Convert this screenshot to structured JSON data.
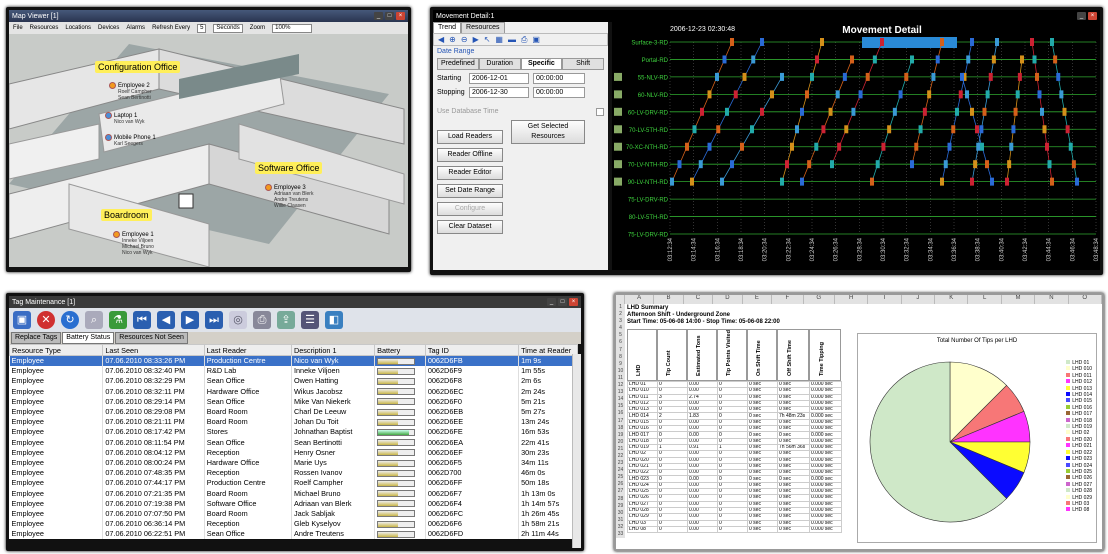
{
  "map_viewer": {
    "title": "Map Viewer [1]",
    "menu": [
      "File",
      "Resources",
      "Locations",
      "Devices",
      "Alarms"
    ],
    "refresh_label": "Refresh Every",
    "refresh_value": "5",
    "refresh_unit": "Seconds",
    "zoom_label": "Zoom",
    "zoom_value": "100%",
    "rooms": {
      "config": "Configuration Office",
      "software": "Software Office",
      "boardroom": "Boardroom"
    },
    "employees": [
      {
        "name": "Employee 2",
        "sub": [
          "Roelf Campher",
          "Sean Bertinotti"
        ]
      },
      {
        "name": "Laptop 1",
        "sub": [
          "Nico van Wyk"
        ]
      },
      {
        "name": "Mobile Phone 1",
        "sub": [
          "Karl Seegers"
        ]
      },
      {
        "name": "Employee 3",
        "sub": [
          "Adriaan van Blerk",
          "Andre Treutens",
          "Willie Claasen"
        ]
      },
      {
        "name": "Employee 1",
        "sub": [
          "Inneke Viljoen",
          "Michael Bruno",
          "Nico van Wyk"
        ]
      }
    ]
  },
  "movement": {
    "title": "Movement Detail:1",
    "tabs": [
      "Trend",
      "Resources"
    ],
    "date_range_label": "Date Range",
    "range_tabs": [
      "Predefined",
      "Duration",
      "Specific",
      "Shift"
    ],
    "starting_label": "Starting",
    "starting_date": "2006-12-01",
    "starting_time": "00:00:00",
    "stopping_label": "Stopping",
    "stopping_date": "2006-12-30",
    "stopping_time": "00:00:00",
    "use_db_time": "Use Database Time",
    "buttons": {
      "load": "Load Readers",
      "get": "Get Selected Resources",
      "offline": "Reader Offline",
      "editor": "Reader Editor",
      "set": "Set Date Range",
      "configure": "Configure",
      "clear": "Clear Dataset"
    },
    "chart_title": "Movement Detail",
    "timestamp": "2006-12-23 02:30:48",
    "lanes": [
      "Surface-3-RD",
      "Portal-RD",
      "55-NLV-RD",
      "60-NLV-RD",
      "60-LV-DRV-RD",
      "70-LV-5TH-RD",
      "70-XC-NTH-RD",
      "70-LV-NTH-RD",
      "90-LV-NTH-RD",
      "75-LV-DRV-RD",
      "80-LV-5TH-RD",
      "75-LV-DRV-RD"
    ],
    "times": [
      "03:12:34",
      "03:14:34",
      "03:16:34",
      "03:18:34",
      "03:20:34",
      "03:22:34",
      "03:24:34",
      "03:26:34",
      "03:28:34",
      "03:30:34",
      "03:32:34",
      "03:34:34",
      "03:36:34",
      "03:38:34",
      "03:40:34",
      "03:42:34",
      "03:44:34",
      "03:46:34",
      "03:48:34"
    ]
  },
  "tag_maint": {
    "title": "Tag Maintenance [1]",
    "tabs": [
      "Replace Tags",
      "Battery Status",
      "Resources Not Seen"
    ],
    "columns": [
      "Resource Type",
      "Last Seen",
      "Last Reader",
      "Description 1",
      "Battery",
      "Tag ID",
      "Time at Reader"
    ],
    "rows": [
      [
        "Employee",
        "07.06.2010 08:33:26 PM",
        "Production Centre",
        "Nico van Wyk",
        "0.55",
        "0062D6FB",
        "1m 9s"
      ],
      [
        "Employee",
        "07.06.2010 08:32:40 PM",
        "R&D Lab",
        "Inneke Viljoen",
        "0.55",
        "0062D6F9",
        "1m 55s"
      ],
      [
        "Employee",
        "07.06.2010 08:32:29 PM",
        "Sean Office",
        "Owen Hatting",
        "0.55",
        "0062D6F8",
        "2m 6s"
      ],
      [
        "Employee",
        "07.06.2010 08:32:11 PM",
        "Hardware Office",
        "Wikus Jacobsz",
        "0.55",
        "0062D6EC",
        "2m 24s"
      ],
      [
        "Employee",
        "07.06.2010 08:29:14 PM",
        "Sean Office",
        "Mike Van Niekerk",
        "0.55",
        "0062D6F0",
        "5m 21s"
      ],
      [
        "Employee",
        "07.06.2010 08:29:08 PM",
        "Board Room",
        "Charl De Leeuw",
        "0.55",
        "0062D6EB",
        "5m 27s"
      ],
      [
        "Employee",
        "07.06.2010 08:21:11 PM",
        "Board Room",
        "Johan Du Toit",
        "0.55",
        "0062D6EE",
        "13m 24s"
      ],
      [
        "Employee",
        "07.06.2010 08:17:42 PM",
        "Stores",
        "Johnathan Baptist",
        "0.85",
        "0062D6FE",
        "16m 53s"
      ],
      [
        "Employee",
        "07.06.2010 08:11:54 PM",
        "Sean Office",
        "Sean Bertinotti",
        "0.55",
        "0062D6EA",
        "22m 41s"
      ],
      [
        "Employee",
        "07.06.2010 08:04:12 PM",
        "Reception",
        "Henry Osner",
        "0.55",
        "0062D6EF",
        "30m 23s"
      ],
      [
        "Employee",
        "07.06.2010 08:00:24 PM",
        "Hardware Office",
        "Marie Uys",
        "0.55",
        "0062D6F5",
        "34m 11s"
      ],
      [
        "Employee",
        "07.06.2010 07:48:35 PM",
        "Reception",
        "Rossen Ivanov",
        "0.55",
        "0062D700",
        "46m 0s"
      ],
      [
        "Employee",
        "07.06.2010 07:44:17 PM",
        "Production Centre",
        "Roelf Campher",
        "0.55",
        "0062D6FF",
        "50m 18s"
      ],
      [
        "Employee",
        "07.06.2010 07:21:35 PM",
        "Board Room",
        "Michael Bruno",
        "0.55",
        "0062D6F7",
        "1h 13m 0s"
      ],
      [
        "Employee",
        "07.06.2010 07:19:38 PM",
        "Software Office",
        "Adriaan van Blerk",
        "0.55",
        "0062D6F4",
        "1h 14m 57s"
      ],
      [
        "Employee",
        "07.06.2010 07:07:50 PM",
        "Board Room",
        "Jack Sabljak",
        "0.55",
        "0062D6FC",
        "1h 26m 45s"
      ],
      [
        "Employee",
        "07.06.2010 06:36:14 PM",
        "Reception",
        "Gleb Kyselyov",
        "0.55",
        "0062D6F6",
        "1h 58m 21s"
      ],
      [
        "Employee",
        "07.06.2010 06:22:51 PM",
        "Sean Office",
        "Andre Treutens",
        "0.55",
        "0062D6FD",
        "2h 11m 44s"
      ]
    ]
  },
  "excel": {
    "columns": [
      "A",
      "B",
      "C",
      "D",
      "E",
      "F",
      "G",
      "H",
      "I",
      "J",
      "K",
      "L",
      "M",
      "N",
      "O"
    ],
    "title1": "LHD Summary",
    "title2": "Afternoon Shift - Underground Zone",
    "title3": "Start Time: 05-06-08 14:00 - Stop Time: 05-06-08 22:00",
    "headers": [
      "LHD",
      "Tip Count",
      "Estimated Tons",
      "Tip Points Visited",
      "On Shift Time",
      "Off Shift Time",
      "Time Tipping"
    ],
    "rows": [
      [
        "LHD 01",
        "0",
        "0.00",
        "0",
        "0 sec",
        "0 sec",
        "0.000 sec"
      ],
      [
        "LHD 010",
        "0",
        "0.00",
        "0",
        "0 sec",
        "0 sec",
        "0.000 sec"
      ],
      [
        "LHD 011",
        "3",
        "2.74",
        "0",
        "0 sec",
        "0 sec",
        "0.000 sec"
      ],
      [
        "LHD 012",
        "0",
        "0.00",
        "0",
        "0 sec",
        "0 sec",
        "0.000 sec"
      ],
      [
        "LHD 013",
        "0",
        "0.00",
        "0",
        "0 sec",
        "0 sec",
        "0.000 sec"
      ],
      [
        "LHD 014",
        "2",
        "1.83",
        "0",
        "0 sec",
        "7h 48m 23s",
        "0.000 sec"
      ],
      [
        "LHD 015",
        "0",
        "0.00",
        "0",
        "0 sec",
        "0 sec",
        "0.000 sec"
      ],
      [
        "LHD 016",
        "0",
        "0.00",
        "0",
        "0 sec",
        "0 sec",
        "0.000 sec"
      ],
      [
        "LHD 017",
        "0",
        "0.00",
        "0",
        "0 sec",
        "0 sec",
        "0.000 sec"
      ],
      [
        "LHD 018",
        "0",
        "0.00",
        "0",
        "0 sec",
        "0 sec",
        "0.000 sec"
      ],
      [
        "LHD 019",
        "1",
        "0.91",
        "1",
        "0 sec",
        "7h 56m 36s",
        "0.000 sec"
      ],
      [
        "LHD 02",
        "0",
        "0.00",
        "0",
        "0 sec",
        "0 sec",
        "0.000 sec"
      ],
      [
        "LHD 020",
        "0",
        "0.00",
        "0",
        "0 sec",
        "0 sec",
        "0.000 sec"
      ],
      [
        "LHD 021",
        "0",
        "0.00",
        "0",
        "0 sec",
        "0 sec",
        "0.000 sec"
      ],
      [
        "LHD 022",
        "0",
        "0.00",
        "0",
        "0 sec",
        "0 sec",
        "0.000 sec"
      ],
      [
        "LHD 023",
        "0",
        "0.00",
        "0",
        "0 sec",
        "0 sec",
        "0.000 sec"
      ],
      [
        "LHD 024",
        "0",
        "0.00",
        "0",
        "0 sec",
        "0 sec",
        "0.000 sec"
      ],
      [
        "LHD 025",
        "0",
        "0.00",
        "0",
        "0 sec",
        "0 sec",
        "0.000 sec"
      ],
      [
        "LHD 026",
        "0",
        "0.00",
        "0",
        "0 sec",
        "0 sec",
        "0.000 sec"
      ],
      [
        "LHD 027",
        "0",
        "0.00",
        "0",
        "0 sec",
        "0 sec",
        "0.000 sec"
      ],
      [
        "LHD 028",
        "0",
        "0.00",
        "0",
        "0 sec",
        "0 sec",
        "0.000 sec"
      ],
      [
        "LHD 029",
        "0",
        "0.00",
        "0",
        "0 sec",
        "0 sec",
        "0.000 sec"
      ],
      [
        "LHD 03",
        "0",
        "0.00",
        "0",
        "0 sec",
        "0 sec",
        "0.000 sec"
      ],
      [
        "LHD 08",
        "0",
        "0.00",
        "0",
        "0 sec",
        "0 sec",
        "0.000 sec"
      ]
    ],
    "chart_title": "Total Number Of Tips per LHD",
    "legend": [
      "LHD 01",
      "LHD 010",
      "LHD 011",
      "LHD 012",
      "LHD 013",
      "LHD 014",
      "LHD 015",
      "LHD 016",
      "LHD 017",
      "LHD 018",
      "LHD 019",
      "LHD 02",
      "LHD 020",
      "LHD 021",
      "LHD 022",
      "LHD 023",
      "LHD 024",
      "LHD 025",
      "LHD 026",
      "LHD 027",
      "LHD 028",
      "LHD 029",
      "LHD 03",
      "LHD 08"
    ]
  },
  "chart_data": {
    "type": "pie",
    "title": "Total Number Of Tips per LHD",
    "categories": [
      "LHD 011",
      "LHD 014",
      "LHD 019",
      "LHD 020",
      "LHD 021",
      "LHD 022",
      "LHD 025"
    ],
    "values": [
      9,
      2,
      1,
      1,
      1,
      1,
      1
    ],
    "colors": [
      "#cfe8c8",
      "#ffffcc",
      "#f77777",
      "#ff33ff",
      "#ffff33",
      "#0b0bff",
      "#cfe8c8"
    ]
  }
}
